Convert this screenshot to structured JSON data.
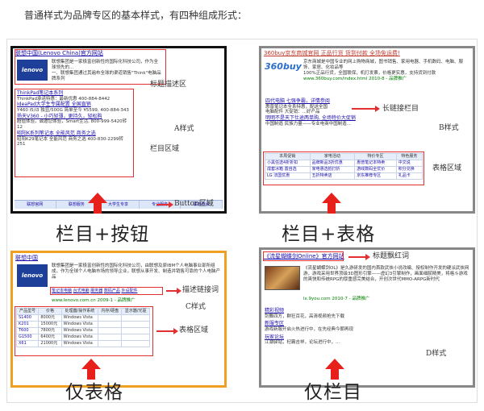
{
  "intro": "普通样式为品牌专区的基本样式，有四种组成形式：",
  "colors": {
    "red": "#e23030",
    "arrow": "#e8201c",
    "frame_black": "#111111",
    "frame_gray": "#888888",
    "frame_orange": "#f0a020",
    "link": "#1a0dab",
    "url": "#008000"
  },
  "card_a": {
    "title": "联想中国(Lenovo China)官方网站",
    "logo": "lenovo",
    "desc": "联想集团是一家极富创新性的国际化科技公司，作为全球领先的...",
    "desc2": "一、联想集团通过其遍布全球的渠道销售\"Think\"电脑品牌系列",
    "label_title": "标题描述区",
    "label_column": "栏目区域",
    "label_button": "Button区域",
    "style_label": "A样式",
    "items": [
      "ThinkPad笔记本系列",
      "ThinkPad承诺特惠：最新优惠 400-884-8442",
      "IdeaPad大学生专属配置 全国直销",
      "Y460 i5/i3 独显/500G 简单至今 ¥5599, 400-884-343",
      "扬天V360 - 小巧轻薄，更持久，轻松购",
      "超值体验，诚邀您体验，Smart生活, 800-999-5420转12",
      "昭阳K系列笔记本 全能风范 商务之选",
      "昭阳K29笔记本 全能风范 商务之选 400-830-2299转251"
    ],
    "buttons": [
      "联想官网",
      "联想服务",
      "大学生专享",
      "专业服务",
      "联想商城"
    ]
  },
  "card_b": {
    "title": "360buy京东商城官网 正品行货 货到付款 全场免运费!",
    "logo": "360buy",
    "desc": "京东商城是中国专业的网上购物商城，图书销售、家用电器、手机数码、电脑、服饰、家居、化妆品等",
    "desc2": "100%正品行货，全国联保，机打发票，价格更实惠，支持货到付款",
    "url": "www.360buy.com/index.html 2010-8 - 品牌推广",
    "label_title": "长链接栏目",
    "label_table": "表格区域",
    "style_label": "B样式",
    "items": [
      "四代电脑 七强争霸，详情参阅",
      "惠普笔记本全系特惠，配送全国",
      "电脑配件 大促销：...好产品",
      "明明不是天下仕途两单购, 全场特价大促销",
      "中国制造 民族力量——专业电商中国制造..."
    ],
    "table": {
      "headers": [
        "本周促销",
        "家电活动",
        "特价专区",
        "特色服务"
      ],
      "rows": [
        [
          "小黑任选4折折扣",
          "品牌新品3折优惠",
          "惠普笔记本特卖",
          "中文说"
        ],
        [
          "成套冰箱 置自选",
          "家电惠选抵打折",
          "游戏数码全优价",
          "积分兑换"
        ],
        [
          "LG 法国优惠",
          "五折特卖店",
          "京东推荐专区",
          "礼品卡"
        ]
      ]
    }
  },
  "card_c": {
    "title": "联想中国",
    "logo": "lenovo",
    "desc": "联想集团是一家极富创新性的国际化科技公司，由联想及原IBM个人电脑事业部所组成，作为全球个人电脑市场的领导企业，联想从事开发、制造并销售可靠的个人电脑产品",
    "links": [
      "笔记本电脑",
      "台式电脑",
      "服务器",
      "数码产品",
      "外设配件"
    ],
    "url": "www.lenovo.com.cn 2009-1 - 品牌推广",
    "label_desc": "描述链接词",
    "label_table": "表格区域",
    "style_label": "C样式",
    "table": {
      "headers": [
        "产品型号",
        "价格",
        "处理器/操作系统",
        "内存/硬盘",
        "显示器/光驱"
      ],
      "rows": [
        [
          "S1400",
          "8000元",
          "Windows Vista",
          "",
          ""
        ],
        [
          "K201",
          "15000元",
          "Windows Vista",
          "",
          ""
        ],
        [
          "T600",
          "7800元",
          "Windows Vista",
          "",
          ""
        ],
        [
          "G1500",
          "6400元",
          "Windows Vista",
          "",
          ""
        ],
        [
          "X61",
          "21000元",
          "Windows Vista",
          "",
          ""
        ]
      ]
    }
  },
  "card_d": {
    "title": "《流星蝴蝶剑Online》官方网站",
    "desc": "《流星蝴蝶剑OL》是久游研发的国内首款武侠小说改编、授权制作开发的硬派武侠网游，游戏采用世界顶级3D图形引擎——虚幻3引擎制作，画面细腻精美，将格斗游戏的爽快和传统RPG的厚重感完美结合，开创次世代MMO-ARPG新时代",
    "url": "lx.9you.com 2010-7 - 品牌推广",
    "label_title": "标题飘红词",
    "style_label": "D样式",
    "sections": [
      {
        "heading": "精彩视频",
        "text": "剑舞四方，群狂百花，高清视频抢先下载"
      },
      {
        "heading": "新服专区",
        "text": "游戏新服开启火热进行中，在先经典今朝再现"
      },
      {
        "heading": "玩家论坛",
        "text": "江湖驿站，杞霸吉祥，论坛进行中，..."
      }
    ]
  },
  "captions": [
    "栏目+按钮",
    "栏目+表格",
    "仅表格",
    "仅栏目"
  ]
}
